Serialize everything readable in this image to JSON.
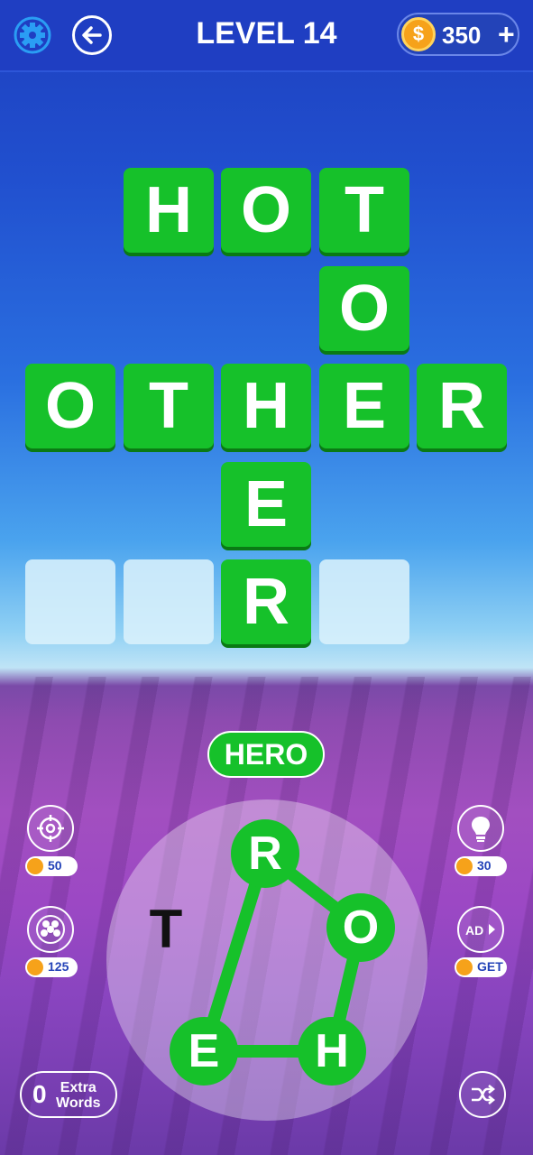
{
  "header": {
    "title": "LEVEL 14",
    "coins": "350",
    "coins_plus": "+",
    "coin_symbol": "$"
  },
  "board": {
    "tiles": [
      {
        "letter": "H",
        "col": 1,
        "row": 0,
        "filled": true
      },
      {
        "letter": "O",
        "col": 2,
        "row": 0,
        "filled": true
      },
      {
        "letter": "T",
        "col": 3,
        "row": 0,
        "filled": true
      },
      {
        "letter": "O",
        "col": 3,
        "row": 1,
        "filled": true
      },
      {
        "letter": "O",
        "col": 0,
        "row": 2,
        "filled": true
      },
      {
        "letter": "T",
        "col": 1,
        "row": 2,
        "filled": true
      },
      {
        "letter": "H",
        "col": 2,
        "row": 2,
        "filled": true
      },
      {
        "letter": "E",
        "col": 3,
        "row": 2,
        "filled": true
      },
      {
        "letter": "R",
        "col": 4,
        "row": 2,
        "filled": true
      },
      {
        "letter": "E",
        "col": 2,
        "row": 3,
        "filled": true
      },
      {
        "letter": "",
        "col": 0,
        "row": 4,
        "filled": false
      },
      {
        "letter": "",
        "col": 1,
        "row": 4,
        "filled": false
      },
      {
        "letter": "R",
        "col": 2,
        "row": 4,
        "filled": true
      },
      {
        "letter": "",
        "col": 3,
        "row": 4,
        "filled": false
      }
    ]
  },
  "current_word": "HERO",
  "wheel": {
    "letters": [
      {
        "letter": "R",
        "selected": true
      },
      {
        "letter": "O",
        "selected": true
      },
      {
        "letter": "H",
        "selected": true
      },
      {
        "letter": "E",
        "selected": true
      },
      {
        "letter": "T",
        "selected": false
      }
    ]
  },
  "boosters": {
    "target": {
      "cost": "50"
    },
    "hint": {
      "cost": "30"
    },
    "multi": {
      "cost": "125"
    },
    "ad": {
      "cost": "GET",
      "label": "AD"
    }
  },
  "extra_words": {
    "count": "0",
    "label_line1": "Extra",
    "label_line2": "Words"
  },
  "colors": {
    "tile_green": "#16c12a",
    "topbar": "#1f3ec2",
    "coin": "#f6a21a"
  }
}
